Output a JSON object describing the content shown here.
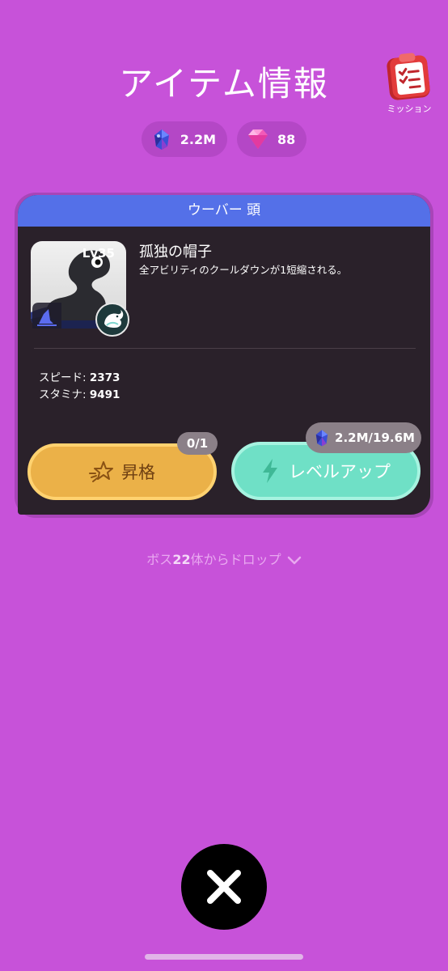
{
  "header": {
    "title": "アイテム情報",
    "mission_label": "ミッション"
  },
  "currency": {
    "crystal": "2.2M",
    "gem": "88"
  },
  "item": {
    "category": "ウーバー 頭",
    "level": "Lv35",
    "name": "孤独の帽子",
    "description": "全アビリティのクールダウンが1短縮される。",
    "stats": [
      {
        "label": "スピード: ",
        "value": "2373"
      },
      {
        "label": "スタミナ: ",
        "value": "9491"
      }
    ]
  },
  "actions": {
    "promote_label": "昇格",
    "promote_count": "0/1",
    "levelup_label": "レベルアップ",
    "levelup_cost": "2.2M/19.6M"
  },
  "drop": {
    "prefix": "ボス",
    "count": "22",
    "suffix": "体からドロップ"
  },
  "colors": {
    "background": "#c752d9",
    "header_bar": "#5470e8",
    "card": "#2a212a",
    "promote": "#ebb148",
    "levelup": "#6fe0c6"
  },
  "icons": [
    "clipboard-icon",
    "crystal-icon",
    "gem-icon",
    "slot-hat-icon",
    "pet-icon",
    "sparkle-star-icon",
    "lightning-icon",
    "chevron-down-icon",
    "close-icon"
  ]
}
